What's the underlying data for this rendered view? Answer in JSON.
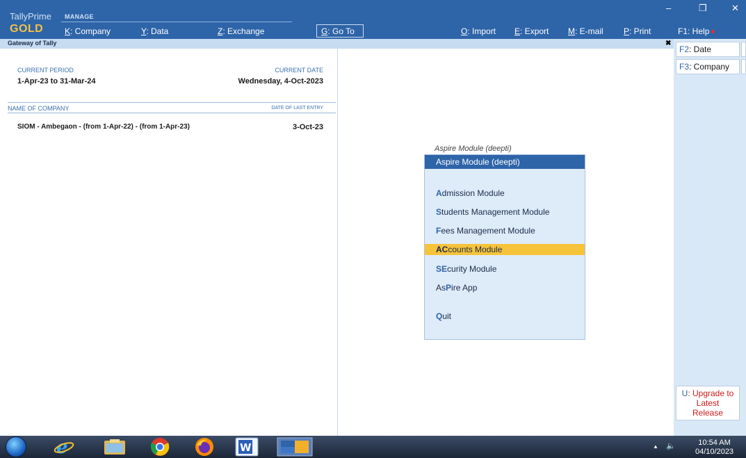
{
  "app": {
    "brand": "TallyPrime",
    "mode": "MANAGE",
    "edition": "GOLD"
  },
  "topmenu": {
    "company": {
      "key": "K",
      "label": ": Company"
    },
    "data": {
      "key": "Y",
      "label": ": Data"
    },
    "exchange": {
      "key": "Z",
      "label": ": Exchange"
    },
    "goto": {
      "key": "G",
      "label": ": Go To"
    },
    "import": {
      "key": "O",
      "label": ": Import"
    },
    "export": {
      "key": "E",
      "label": ": Export"
    },
    "email": {
      "key": "M",
      "label": ": E-mail"
    },
    "print": {
      "key": "P",
      "label": ": Print"
    },
    "help": {
      "key": "F1",
      "label": ": Help"
    }
  },
  "window": {
    "minimize": "–",
    "restore": "❐",
    "close": "✕"
  },
  "gateway": {
    "title": "Gateway of Tally",
    "close": "✖",
    "current_period_label": "CURRENT PERIOD",
    "current_period": "1-Apr-23 to 31-Mar-24",
    "current_date_label": "CURRENT DATE",
    "current_date": "Wednesday, 4-Oct-2023",
    "company_col": "NAME OF COMPANY",
    "last_entry_col": "DATE OF LAST ENTRY",
    "companies": [
      {
        "name": "SIOM - Ambegaon -  (from 1-Apr-22) - (from 1-Apr-23)",
        "last_entry": "3-Oct-23"
      }
    ]
  },
  "module_menu": {
    "caption": "Aspire Module (deepti)",
    "header": "Aspire Module (deepti)",
    "items": [
      {
        "hk": "A",
        "rest": "dmission Module"
      },
      {
        "hk": "S",
        "rest": "tudents Management Module"
      },
      {
        "hk": "F",
        "rest": "ees Management Module"
      },
      {
        "hk": "AC",
        "rest": "counts Module"
      },
      {
        "pre": "S",
        "hk": "E",
        "rest": "curity Module"
      },
      {
        "pre": "As",
        "hk": "P",
        "rest": "ire App"
      },
      {
        "hk": "Q",
        "rest": "uit"
      }
    ]
  },
  "sidebar": {
    "date": {
      "key": "F2",
      "label": ": Date"
    },
    "company": {
      "key": "F3",
      "label": ": Company"
    },
    "upgrade": {
      "key": "U",
      "label": ": Upgrade to",
      "line2": "Latest",
      "line3": "Release"
    }
  },
  "taskbar": {
    "time": "10:54 AM",
    "date": "04/10/2023",
    "tray_arrow": "▲",
    "volume": "🔈"
  },
  "colors": {
    "primary": "#2e64a8",
    "highlight": "#f7c33a",
    "gold": "#f3c245",
    "alert": "#d01a1a"
  }
}
